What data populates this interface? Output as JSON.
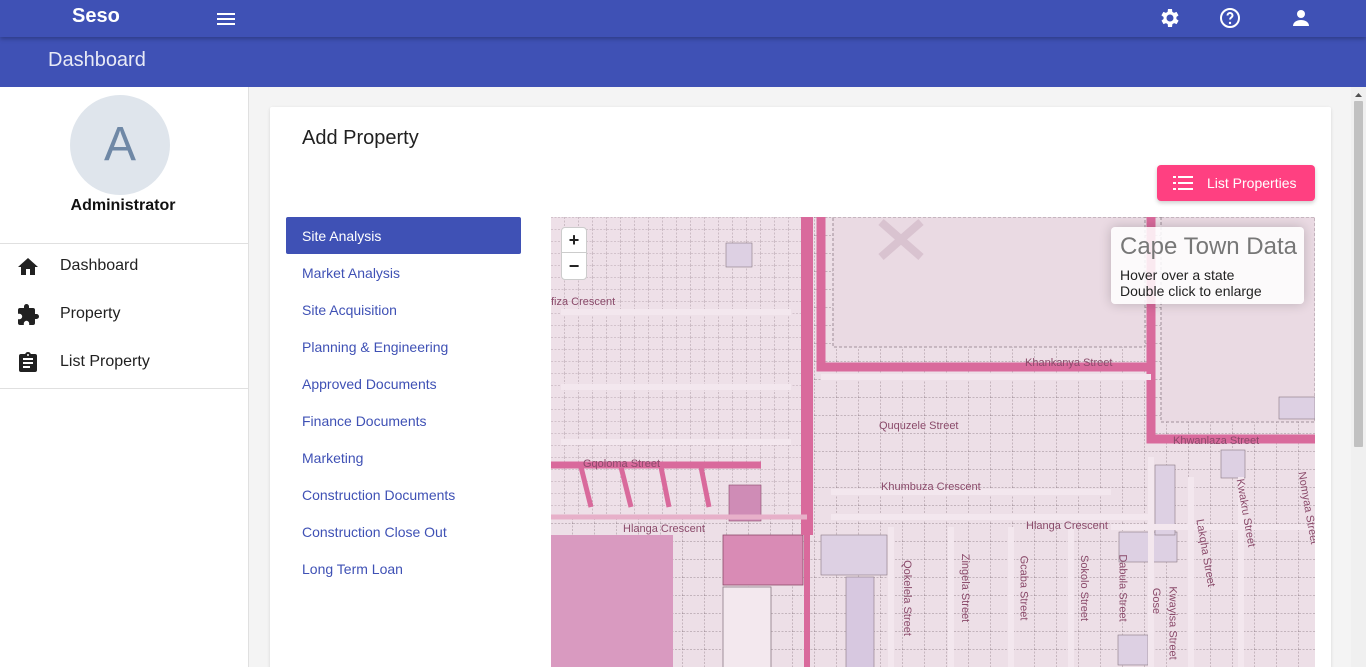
{
  "app": {
    "brand": "Seso",
    "page_title": "Dashboard"
  },
  "top_icons": [
    "menu-icon",
    "settings-icon",
    "help-icon",
    "account-icon"
  ],
  "user": {
    "avatar_initial": "A",
    "role": "Administrator"
  },
  "sidebar": {
    "items": [
      {
        "label": "Dashboard",
        "icon": "home-icon"
      },
      {
        "label": "Property",
        "icon": "puzzle-icon"
      },
      {
        "label": "List Property",
        "icon": "clipboard-icon"
      }
    ]
  },
  "card": {
    "title": "Add Property",
    "list_button": "List Properties"
  },
  "steps": [
    {
      "label": "Site Analysis",
      "active": true
    },
    {
      "label": "Market Analysis",
      "active": false
    },
    {
      "label": "Site Acquisition",
      "active": false
    },
    {
      "label": "Planning & Engineering",
      "active": false
    },
    {
      "label": "Approved Documents",
      "active": false
    },
    {
      "label": "Finance Documents",
      "active": false
    },
    {
      "label": "Marketing",
      "active": false
    },
    {
      "label": "Construction Documents",
      "active": false
    },
    {
      "label": "Construction Close Out",
      "active": false
    },
    {
      "label": "Long Term Loan",
      "active": false
    }
  ],
  "map": {
    "zoom_in": "+",
    "zoom_out": "−",
    "info_title": "Cape Town Data",
    "info_line1": "Hover over a state",
    "info_line2": "Double click to enlarge",
    "streets": [
      "fiza Crescent",
      "Khankanya Street",
      "Ququzele Street",
      "Khwanlaza Street",
      "Gqoloma Street",
      "Khumbuza Crescent",
      "Hlanga Crescent",
      "Hlanga Crescent",
      "Qokelela Street",
      "Zingela Street",
      "Gcaba Street",
      "Sokolo Street",
      "Dabula Street",
      "Kwayisa Street",
      "Lakqha Street",
      "Kwakru Street",
      "Nomyaa Street",
      "Gose"
    ]
  },
  "colors": {
    "primary": "#3f51b5",
    "accent": "#ff4081",
    "map_bg": "#ecdde6",
    "road": "#d96a9c"
  }
}
